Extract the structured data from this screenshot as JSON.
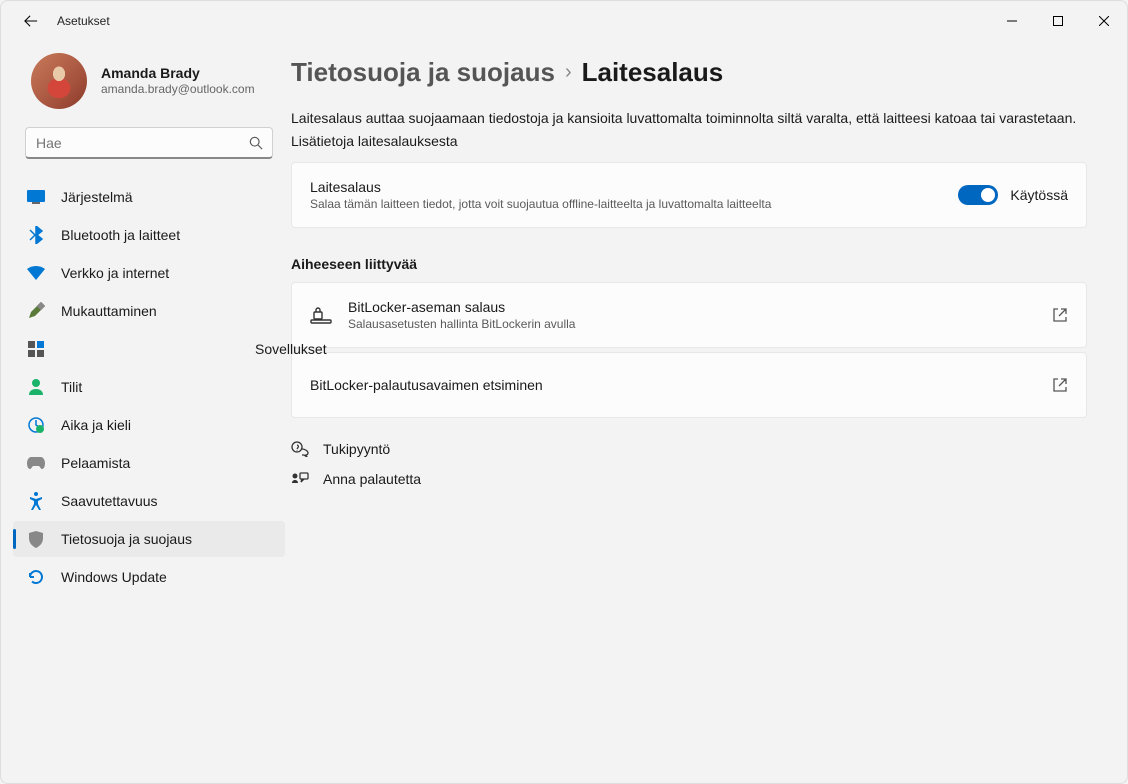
{
  "app_title": "Asetukset",
  "profile": {
    "name": "Amanda Brady",
    "email": "amanda.brady@outlook.com"
  },
  "search": {
    "placeholder": "Hae"
  },
  "nav": {
    "items": [
      "Järjestelmä",
      "Bluetooth ja laitteet",
      "Verkko ja internet",
      "Mukauttaminen",
      "",
      "Tilit",
      "Aika ja kieli",
      "Pelaamista",
      "Saavutettavuus",
      "Tietosuoja ja suojaus",
      "Windows Update"
    ],
    "overflow_label": "Sovellukset"
  },
  "breadcrumb": {
    "parent": "Tietosuoja ja suojaus",
    "current": "Laitesalaus"
  },
  "description": "Laitesalaus auttaa suojaamaan tiedostoja ja kansioita luvattomalta toiminnolta siltä varalta, että laitteesi katoaa tai varastetaan.",
  "description_link": "Lisätietoja laitesalauksesta",
  "toggle_card": {
    "title": "Laitesalaus",
    "subtitle": "Salaa tämän laitteen tiedot, jotta voit suojautua offline-laitteelta ja luvattomalta laitteelta",
    "state_label": "Käytössä"
  },
  "related_header": "Aiheeseen liittyvää",
  "related": [
    {
      "title": "BitLocker-aseman salaus",
      "subtitle": "Salausasetusten hallinta BitLockerin avulla"
    },
    {
      "title": "BitLocker-palautusavaimen etsiminen"
    }
  ],
  "footer": {
    "help": "Tukipyyntö",
    "feedback": "Anna palautetta"
  }
}
